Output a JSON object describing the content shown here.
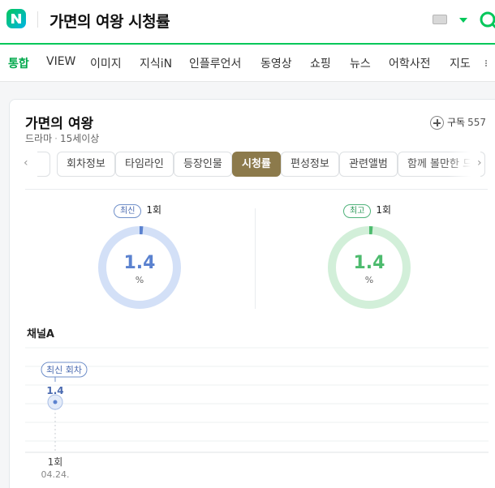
{
  "header": {
    "query": "가면의 여왕 시청률",
    "logo_icon": "naver-n-logo",
    "colors": {
      "brand": "#03c75a"
    }
  },
  "nav": {
    "items": [
      {
        "label": "통합",
        "active": true
      },
      {
        "label": "VIEW"
      },
      {
        "label": "이미지"
      },
      {
        "label": "지식iN"
      },
      {
        "label": "인플루언서"
      },
      {
        "label": "동영상"
      },
      {
        "label": "쇼핑"
      },
      {
        "label": "뉴스"
      },
      {
        "label": "어학사전"
      },
      {
        "label": "지도"
      }
    ]
  },
  "card": {
    "title": "가면의 여왕",
    "genre": "드라마",
    "dot": "·",
    "rating": "15세이상",
    "follow_label": "구독",
    "follow_count": "557",
    "tabs": [
      {
        "label": "회차정보"
      },
      {
        "label": "타임라인"
      },
      {
        "label": "등장인물"
      },
      {
        "label": "시청률",
        "active": true
      },
      {
        "label": "편성정보"
      },
      {
        "label": "관련앨범"
      },
      {
        "label": "함께 볼만한 드"
      }
    ],
    "latest": {
      "badge": "최신",
      "episode": "1회",
      "value": "1.4",
      "unit": "%",
      "percent": 1.4,
      "color": "#5b82cf",
      "track": "#d3e0f7"
    },
    "best": {
      "badge": "최고",
      "episode": "1회",
      "value": "1.4",
      "unit": "%",
      "percent": 1.4,
      "color": "#4dbb6e",
      "track": "#d2efd9"
    }
  },
  "chart_data": {
    "type": "line",
    "title": "채널A",
    "x": [
      "1회"
    ],
    "dates": [
      "04.24."
    ],
    "series": [
      {
        "values": [
          1.4
        ]
      }
    ],
    "annotation": "최신 회차",
    "grid": true,
    "color": "#5b82cf"
  }
}
